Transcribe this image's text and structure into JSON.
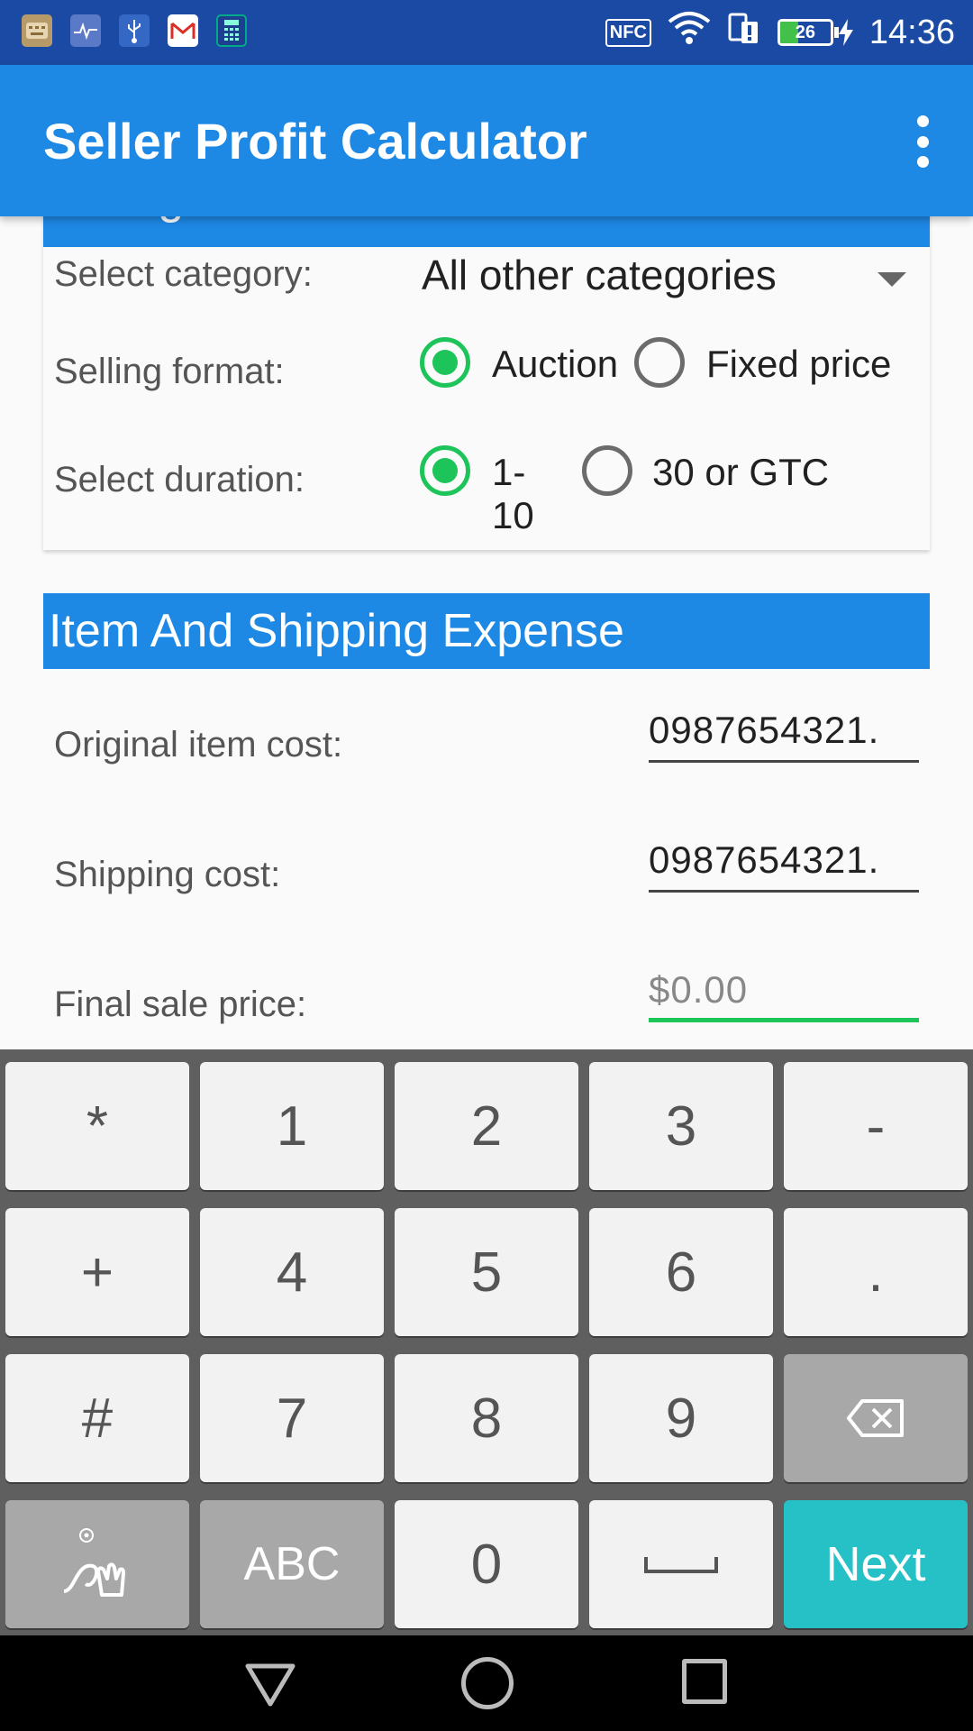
{
  "status_bar": {
    "time": "14:36",
    "battery_level": "26",
    "nfc_label": "NFC",
    "notification_icons": [
      "keyboard-icon",
      "health-icon",
      "usb-icon",
      "gmail-icon",
      "calculator-icon"
    ]
  },
  "app_bar": {
    "title": "Seller Profit Calculator"
  },
  "listing_section": {
    "header": "Listing Information",
    "category_label": "Select category:",
    "category_value": "All other categories",
    "format_label": "Selling format:",
    "format_options": [
      "Auction",
      "Fixed price"
    ],
    "format_selected": "Auction",
    "duration_label": "Select duration:",
    "duration_options": [
      "1-10",
      "30 or GTC"
    ],
    "duration_selected": "1-10"
  },
  "expense_section": {
    "header": "Item And Shipping Expense",
    "original_cost_label": "Original item cost:",
    "original_cost_value": "0987654321.",
    "shipping_cost_label": "Shipping cost:",
    "shipping_cost_value": "0987654321.",
    "final_price_label": "Final sale price:",
    "final_price_placeholder": "$0.00"
  },
  "keyboard": {
    "rows": [
      [
        "*",
        "1",
        "2",
        "3",
        "-"
      ],
      [
        "+",
        "4",
        "5",
        "6",
        "."
      ],
      [
        "#",
        "7",
        "8",
        "9",
        ""
      ],
      [
        "",
        "ABC",
        "0",
        "",
        "Next"
      ]
    ]
  },
  "colors": {
    "status_bar": "#1a4aa3",
    "app_bar": "#1e88e5",
    "accent_green": "#1cc45a",
    "next_key": "#26c0c7"
  }
}
